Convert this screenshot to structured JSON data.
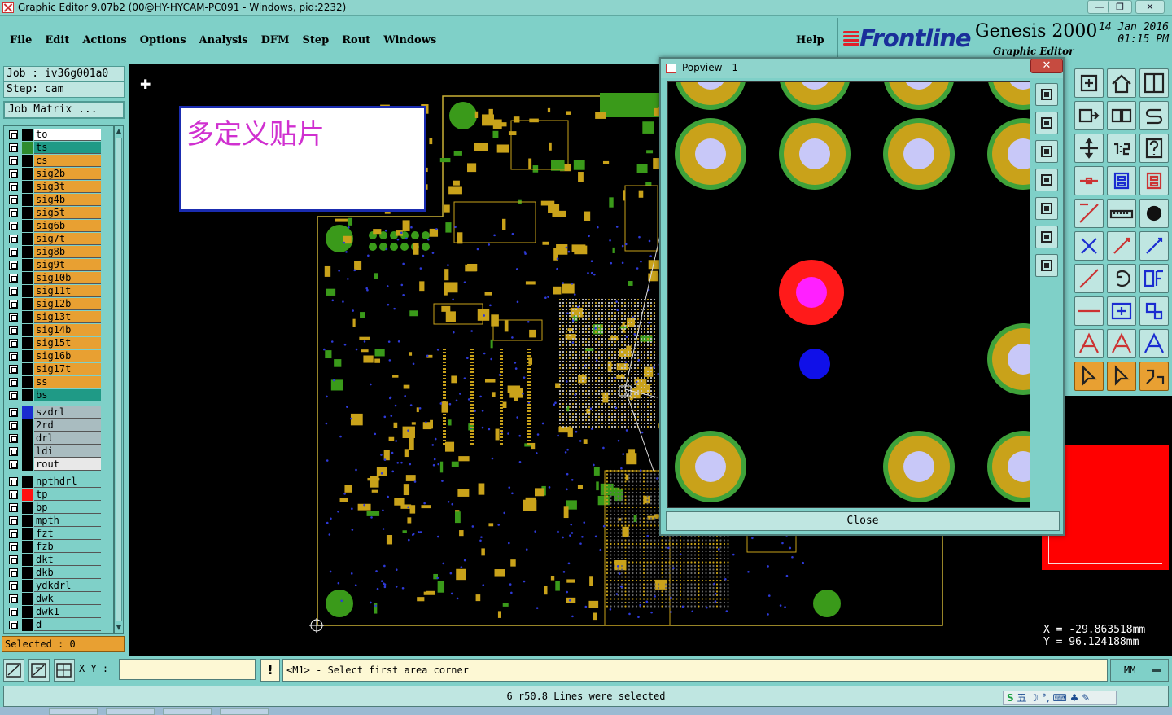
{
  "window": {
    "title": "Graphic Editor 9.07b2 (00@HY-HYCAM-PC091 - Windows, pid:2232)",
    "minimize": "—",
    "maximize": "❐",
    "close": "✕"
  },
  "menu": {
    "items": [
      "File",
      "Edit",
      "Actions",
      "Options",
      "Analysis",
      "DFM",
      "Step",
      "Rout",
      "Windows"
    ],
    "help": "Help"
  },
  "brand": {
    "logo": "Frontline",
    "product": "Genesis 2000",
    "subtitle": "Graphic Editor",
    "date": "14 Jan 2016",
    "time": "01:15 PM",
    "logo_color": "#1a2f9a",
    "accent_color": "#e0202a"
  },
  "job": {
    "job_label": "Job  :  iv36g001a0",
    "step_label": "Step: cam",
    "matrix_button": "Job Matrix ..."
  },
  "layers": [
    {
      "name": "to",
      "bg": "#ffffff",
      "swatch": "#000000"
    },
    {
      "name": "ts",
      "bg": "#1f9a86",
      "swatch": "#2e8b2e"
    },
    {
      "name": "cs",
      "bg": "#e8a032",
      "swatch": "#000000"
    },
    {
      "name": "sig2b",
      "bg": "#e8a032",
      "swatch": "#000000"
    },
    {
      "name": "sig3t",
      "bg": "#e8a032",
      "swatch": "#000000"
    },
    {
      "name": "sig4b",
      "bg": "#e8a032",
      "swatch": "#000000"
    },
    {
      "name": "sig5t",
      "bg": "#e8a032",
      "swatch": "#000000"
    },
    {
      "name": "sig6b",
      "bg": "#e8a032",
      "swatch": "#000000"
    },
    {
      "name": "sig7t",
      "bg": "#e8a032",
      "swatch": "#000000"
    },
    {
      "name": "sig8b",
      "bg": "#e8a032",
      "swatch": "#000000"
    },
    {
      "name": "sig9t",
      "bg": "#e8a032",
      "swatch": "#000000"
    },
    {
      "name": "sig10b",
      "bg": "#e8a032",
      "swatch": "#000000"
    },
    {
      "name": "sig11t",
      "bg": "#e8a032",
      "swatch": "#000000"
    },
    {
      "name": "sig12b",
      "bg": "#e8a032",
      "swatch": "#000000"
    },
    {
      "name": "sig13t",
      "bg": "#e8a032",
      "swatch": "#000000"
    },
    {
      "name": "sig14b",
      "bg": "#e8a032",
      "swatch": "#000000"
    },
    {
      "name": "sig15t",
      "bg": "#e8a032",
      "swatch": "#000000"
    },
    {
      "name": "sig16b",
      "bg": "#e8a032",
      "swatch": "#000000"
    },
    {
      "name": "sig17t",
      "bg": "#e8a032",
      "swatch": "#000000"
    },
    {
      "name": "ss",
      "bg": "#e8a032",
      "swatch": "#000000"
    },
    {
      "name": "bs",
      "bg": "#1f9a86",
      "swatch": "#000000"
    },
    {
      "name": "szdrl",
      "bg": "#a9bcc0",
      "swatch": "#1a2cd0"
    },
    {
      "name": "2rd",
      "bg": "#a9bcc0",
      "swatch": "#000000"
    },
    {
      "name": "drl",
      "bg": "#a9bcc0",
      "swatch": "#000000"
    },
    {
      "name": "ldi",
      "bg": "#a9bcc0",
      "swatch": "#000000"
    },
    {
      "name": "rout",
      "bg": "#e8e8e8",
      "swatch": "#000000"
    },
    {
      "name": "npthdrl",
      "bg": "#7fd0c8",
      "swatch": "#000000"
    },
    {
      "name": "tp",
      "bg": "#7fd0c8",
      "swatch": "#ff1010"
    },
    {
      "name": "bp",
      "bg": "#7fd0c8",
      "swatch": "#000000"
    },
    {
      "name": "mpth",
      "bg": "#7fd0c8",
      "swatch": "#000000"
    },
    {
      "name": "fzt",
      "bg": "#7fd0c8",
      "swatch": "#000000"
    },
    {
      "name": "fzb",
      "bg": "#7fd0c8",
      "swatch": "#000000"
    },
    {
      "name": "dkt",
      "bg": "#7fd0c8",
      "swatch": "#000000"
    },
    {
      "name": "dkb",
      "bg": "#7fd0c8",
      "swatch": "#000000"
    },
    {
      "name": "ydkdrl",
      "bg": "#7fd0c8",
      "swatch": "#000000"
    },
    {
      "name": "dwk",
      "bg": "#7fd0c8",
      "swatch": "#000000"
    },
    {
      "name": "dwk1",
      "bg": "#7fd0c8",
      "swatch": "#000000"
    },
    {
      "name": "d",
      "bg": "#7fd0c8",
      "swatch": "#000000"
    }
  ],
  "selected_text": "Selected : 0",
  "canvas": {
    "note": "多定义贴片",
    "note_color": "#d030d0"
  },
  "popview": {
    "title": "Popview - 1",
    "close_x": "✕",
    "close_button": "Close"
  },
  "coords": {
    "x": "X  =  -29.863518mm",
    "y": "Y  =  96.124188mm"
  },
  "status": {
    "xy_label": "X Y :",
    "xy_value": "",
    "warn": "!",
    "prompt": "<M1> - Select first area corner",
    "units": "MM",
    "message": "6 r50.8 Lines were selected"
  },
  "ime": {
    "badge": "S",
    "text": "五 ☽ °, ⌨ ♣ ✎"
  }
}
